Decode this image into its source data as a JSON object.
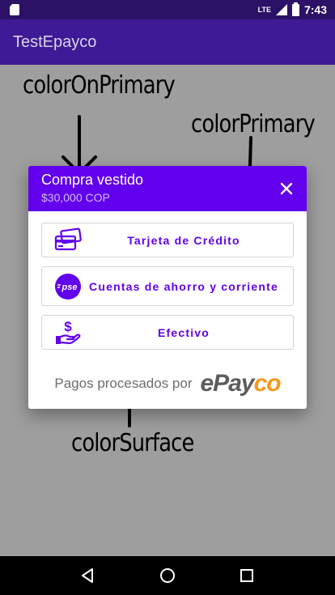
{
  "status_bar": {
    "network": "LTE",
    "time": "7:43"
  },
  "app_bar": {
    "title": "TestEpayco"
  },
  "annotations": {
    "top_left": "colorOnPrimary",
    "top_right": "colorPrimary",
    "bottom": "colorSurface"
  },
  "dialog": {
    "title": "Compra vestido",
    "amount": "$30,000 COP",
    "options": [
      {
        "label": "Tarjeta de Crédito",
        "icon": "credit-card-icon"
      },
      {
        "label": "Cuentas de ahorro y corriente",
        "icon": "pse-icon",
        "icon_text": "pse"
      },
      {
        "label": "Efectivo",
        "icon": "cash-hand-icon"
      }
    ],
    "footer_text": "Pagos procesados por",
    "brand": {
      "part1": "ePay",
      "part2": "co"
    }
  },
  "colors": {
    "primary": "#6200ee",
    "primary_dark": "#3700b3",
    "surface": "#ffffff",
    "brand_orange": "#f59a1c"
  }
}
